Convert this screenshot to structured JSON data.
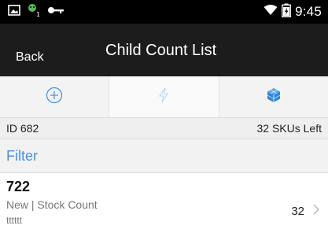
{
  "status_bar": {
    "time": "9:45",
    "icons": [
      "gallery-icon",
      "android-notification-icon",
      "key-icon",
      "wifi-icon",
      "battery-icon"
    ]
  },
  "action_bar": {
    "back_label": "Back",
    "title": "Child Count List"
  },
  "tabs": [
    {
      "icon": "add-circle-icon",
      "active": false
    },
    {
      "icon": "lightning-icon",
      "active": true
    },
    {
      "icon": "cube-icon",
      "active": false
    }
  ],
  "info": {
    "id_label": "ID 682",
    "skus_left": "32 SKUs Left"
  },
  "filter": {
    "label": "Filter"
  },
  "list": [
    {
      "id": "722",
      "subtitle": "New | Stock Count",
      "note": "tttttt",
      "count": "32"
    }
  ],
  "colors": {
    "status_bar_bg": "#000000",
    "action_bar_bg": "#1c1c1c",
    "accent": "#4a90d9",
    "tab_icon_color": "#2196f3"
  }
}
